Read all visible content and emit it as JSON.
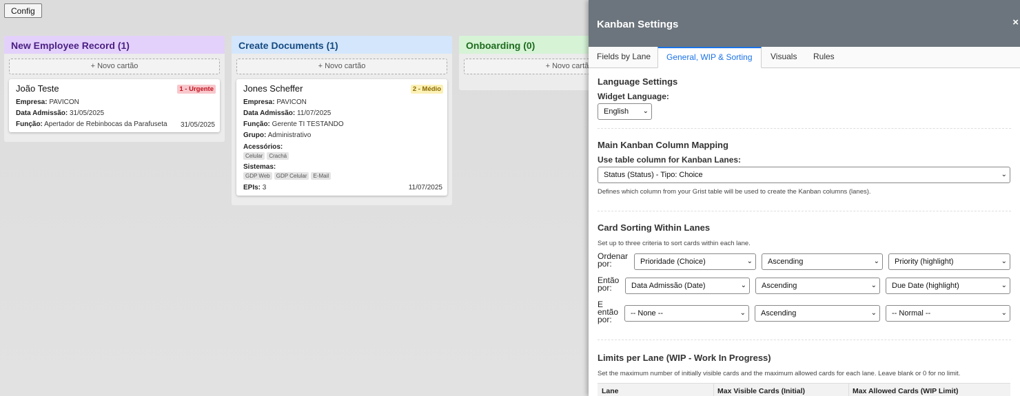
{
  "toolbar": {
    "config_label": "Config"
  },
  "lanes": [
    {
      "title": "New Employee Record (1)",
      "header_bg": "#e3d1fb",
      "header_color": "#4a1f82",
      "add_label": "+ Novo cartão",
      "cards": [
        {
          "title": "João Teste",
          "priority": "1 - Urgente",
          "priority_bg": "#f8c7cc",
          "priority_color": "#c0121e",
          "fields": [
            {
              "label": "Empresa:",
              "value": "PAVICON"
            },
            {
              "label": "Data Admissão:",
              "value": "31/05/2025"
            },
            {
              "label": "Função:",
              "value": "Apertador de Rebinbocas da Parafuseta"
            }
          ],
          "date": "31/05/2025"
        }
      ]
    },
    {
      "title": "Create Documents (1)",
      "header_bg": "#d3e6fb",
      "header_color": "#154a82",
      "add_label": "+ Novo cartão",
      "cards": [
        {
          "title": "Jones Scheffer",
          "priority": "2 - Médio",
          "priority_bg": "#fbf0b5",
          "priority_color": "#8a6a00",
          "fields": [
            {
              "label": "Empresa:",
              "value": "PAVICON"
            },
            {
              "label": "Data Admissão:",
              "value": "11/07/2025"
            },
            {
              "label": "Função:",
              "value": "Gerente TI TESTANDO"
            },
            {
              "label": "Grupo:",
              "value": "Administrativo"
            }
          ],
          "acessorios_label": "Acessórios:",
          "acessorios": [
            "Celular",
            "Crachá"
          ],
          "sistemas_label": "Sistemas:",
          "sistemas": [
            "GDP Web",
            "GDP Celular",
            "E-Mail"
          ],
          "epis_label": "EPIs:",
          "epis_value": "3",
          "date": "11/07/2025"
        }
      ]
    },
    {
      "title": "Onboarding (0)",
      "header_bg": "#d6f3d6",
      "header_color": "#1e6b1e",
      "add_label": "+ Novo cartão",
      "cards": []
    }
  ],
  "panel": {
    "title": "Kanban Settings",
    "close_label": "×",
    "tabs": [
      {
        "label": "Fields by Lane"
      },
      {
        "label": "General, WIP & Sorting",
        "active": true
      },
      {
        "label": "Visuals"
      },
      {
        "label": "Rules"
      }
    ],
    "language": {
      "title": "Language Settings",
      "label": "Widget Language:",
      "value": "English"
    },
    "mapping": {
      "title": "Main Kanban Column Mapping",
      "label": "Use table column for Kanban Lanes:",
      "value": "Status (Status) - Tipo: Choice",
      "hint": "Defines which column from your Grist table will be used to create the Kanban columns (lanes)."
    },
    "sorting": {
      "title": "Card Sorting Within Lanes",
      "hint": "Set up to three criteria to sort cards within each lane.",
      "rows": [
        {
          "label_line1": "Ordenar",
          "label_line2": "por:",
          "label_line3": "",
          "field": "Prioridade (Choice)",
          "direction": "Ascending",
          "highlight": "Priority (highlight)"
        },
        {
          "label_line1": "Então",
          "label_line2": "por:",
          "label_line3": "",
          "field": "Data Admissão (Date)",
          "direction": "Ascending",
          "highlight": "Due Date (highlight)"
        },
        {
          "label_line1": "E",
          "label_line2": "então",
          "label_line3": "por:",
          "field": "-- None --",
          "direction": "Ascending",
          "highlight": "-- Normal --"
        }
      ]
    },
    "wip": {
      "title": "Limits per Lane (WIP - Work In Progress)",
      "hint": "Set the maximum number of initially visible cards and the maximum allowed cards for each lane. Leave blank or 0 for no limit.",
      "columns": [
        "Lane",
        "Max Visible Cards (Initial)",
        "Max Allowed Cards (WIP Limit)"
      ]
    }
  }
}
